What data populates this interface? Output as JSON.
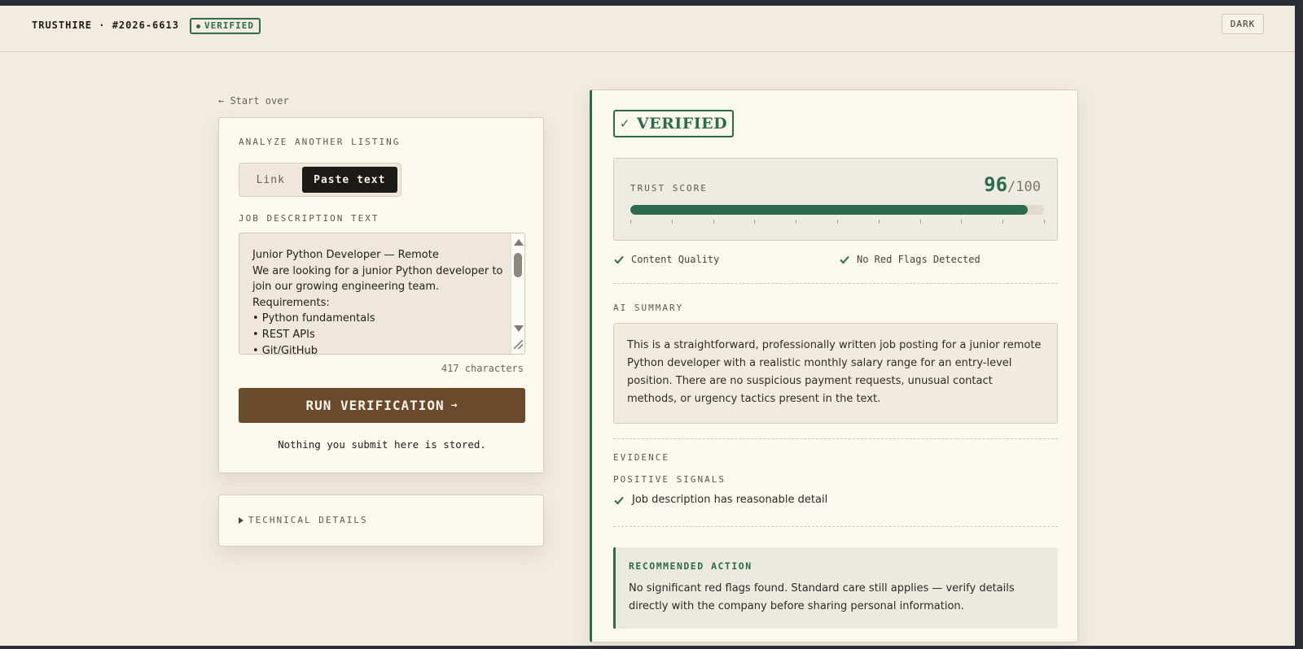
{
  "header": {
    "brand": "TRUSTHIRE · #2026-6613",
    "badge": "VERIFIED",
    "theme_toggle": "DARK"
  },
  "nav": {
    "start_over": "← Start over"
  },
  "analyze": {
    "section_label": "ANALYZE ANOTHER LISTING",
    "tabs": [
      {
        "label": "Link",
        "active": false
      },
      {
        "label": "Paste text",
        "active": true
      }
    ],
    "field_label": "JOB DESCRIPTION TEXT",
    "textarea_value": "Junior Python Developer — Remote\nWe are looking for a junior Python developer to join our growing engineering team.\nRequirements:\n• Python fundamentals\n• REST APIs\n• Git/GitHub",
    "char_count": "417 characters",
    "run_button": "RUN VERIFICATION",
    "run_arrow": "→",
    "privacy_note": "Nothing you submit here is stored."
  },
  "technical": {
    "label": "TECHNICAL DETAILS"
  },
  "result": {
    "status_check": "✓",
    "status": "VERIFIED",
    "trust_label": "TRUST SCORE",
    "score": "96",
    "score_max": "/100",
    "score_fraction": 0.96,
    "checks": [
      "Content Quality",
      "No Red Flags Detected"
    ],
    "ai_summary_label": "AI SUMMARY",
    "ai_summary": "This is a straightforward, professionally written job posting for a junior remote Python developer with a realistic monthly salary range for an entry-level position. There are no suspicious payment requests, unusual contact methods, or urgency tactics present in the text.",
    "evidence_label": "EVIDENCE",
    "positive_label": "POSITIVE SIGNALS",
    "positive_signals": [
      "Job description has reasonable detail"
    ],
    "recommended_label": "RECOMMENDED ACTION",
    "recommended_text": "No significant red flags found. Standard care still applies — verify details directly with the company before sharing personal information."
  },
  "colors": {
    "accent_green": "#2e6b4e",
    "button_brown": "#6a4a2c",
    "page_bg": "#f2ece0",
    "card_bg": "#fbf8ee"
  },
  "icons": {
    "check": "check-icon",
    "back_arrow": "arrow-left-icon",
    "disclosure": "triangle-right-icon"
  }
}
